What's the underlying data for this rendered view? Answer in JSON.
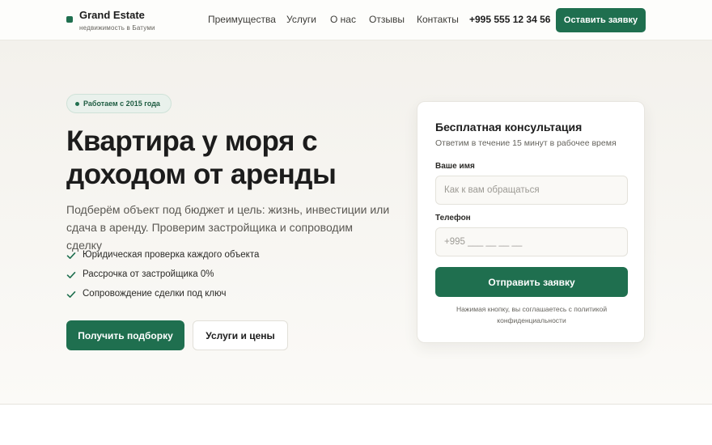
{
  "header": {
    "brand": "Grand Estate",
    "brand_sub": "недвижимость в Батуми",
    "nav": [
      "Преимущества",
      "Услуги",
      "О нас",
      "Отзывы",
      "Контакты"
    ],
    "phone": "+995 555 12 34 56",
    "cta": "Оставить заявку"
  },
  "hero": {
    "badge": "Работаем с 2015 года",
    "title": "Квартира у моря с доходом от аренды",
    "subtitle": "Подберём объект под бюджет и цель: жизнь, инвестиции или сдача в аренду. Проверим застройщика и сопроводим сделку",
    "features": [
      "Юридическая проверка каждого объекта",
      "Рассрочка от застройщика 0%",
      "Сопровождение сделки под ключ"
    ],
    "primary_button": "Получить подборку",
    "secondary_button": "Услуги и цены"
  },
  "form": {
    "title": "Бесплатная консультация",
    "subtitle": "Ответим в течение 15 минут в рабочее время",
    "name_label": "Ваше имя",
    "name_placeholder": "Как к вам обращаться",
    "phone_label": "Телефон",
    "phone_placeholder": "+995 ___ __ __ __",
    "submit": "Отправить заявку",
    "consent": "Нажимая кнопку, вы соглашаетесь с политикой конфиденциальности"
  },
  "colors": {
    "accent": "#1f6f4f",
    "text": "#1c1c1c",
    "muted": "#66645e",
    "hero_bg": "#f3f1ec"
  },
  "icons": {
    "feature_bullet": "check-icon"
  }
}
